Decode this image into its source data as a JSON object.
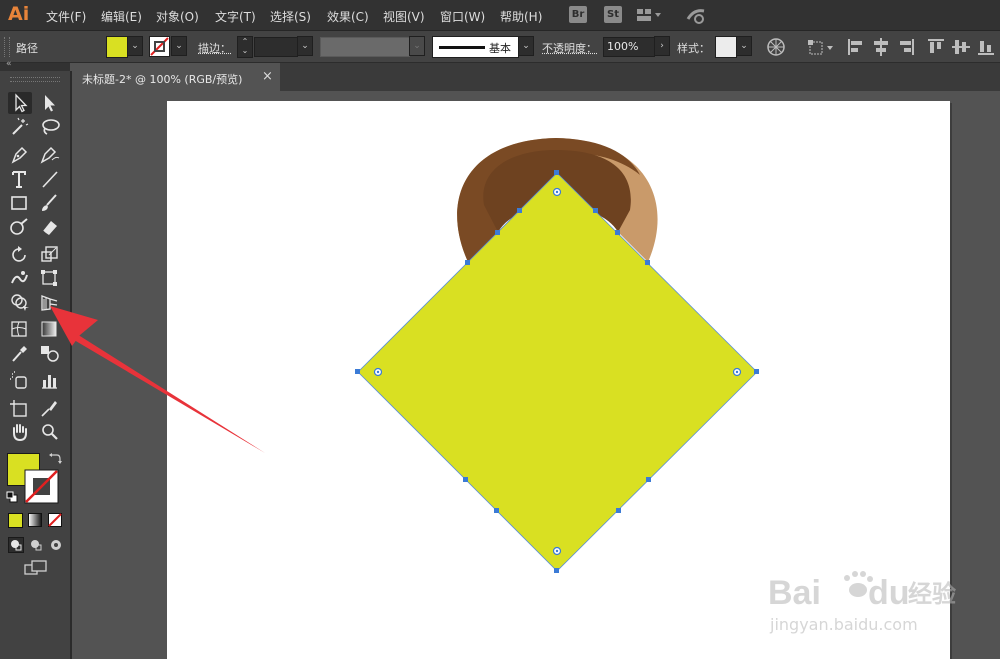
{
  "app": {
    "logo": "Ai"
  },
  "menu": [
    "文件(F)",
    "编辑(E)",
    "对象(O)",
    "文字(T)",
    "选择(S)",
    "效果(C)",
    "视图(V)",
    "窗口(W)",
    "帮助(H)"
  ],
  "menu_badges": {
    "bridge": "Br",
    "stock": "St"
  },
  "controlbar": {
    "object_type": "路径",
    "stroke_label": "描边：",
    "stroke_style": "基本",
    "opacity_label": "不透明度：",
    "opacity_value": "100%",
    "style_label": "样式："
  },
  "colors": {
    "fill": "#d9e022",
    "diamond": "#d9e022",
    "handle_dark": "#7a4a24",
    "handle_light": "#c99a6a",
    "anchor": "#3b7bd6",
    "annotation_arrow": "#e8333a"
  },
  "document_tab": {
    "title": "未标题-2* @ 100% (RGB/预览)",
    "close": "×"
  },
  "icons": [
    "selection-tool-icon",
    "direct-selection-tool-icon",
    "magic-wand-icon",
    "lasso-icon",
    "pen-icon",
    "curvature-icon",
    "type-icon",
    "line-icon",
    "rectangle-icon",
    "paintbrush-icon",
    "shaper-icon",
    "eraser-icon",
    "rotate-icon",
    "scale-icon",
    "warp-icon",
    "free-transform-icon",
    "shape-builder-icon",
    "perspective-grid-icon",
    "mesh-icon",
    "gradient-icon",
    "eyedropper-icon",
    "blend-icon",
    "symbol-sprayer-icon",
    "column-graph-icon",
    "artboard-icon",
    "slice-icon",
    "hand-icon",
    "zoom-icon"
  ],
  "watermark": {
    "brand": "Bai",
    "brand2": "du",
    "cn": "经验",
    "url": "jingyan.baidu.com"
  }
}
